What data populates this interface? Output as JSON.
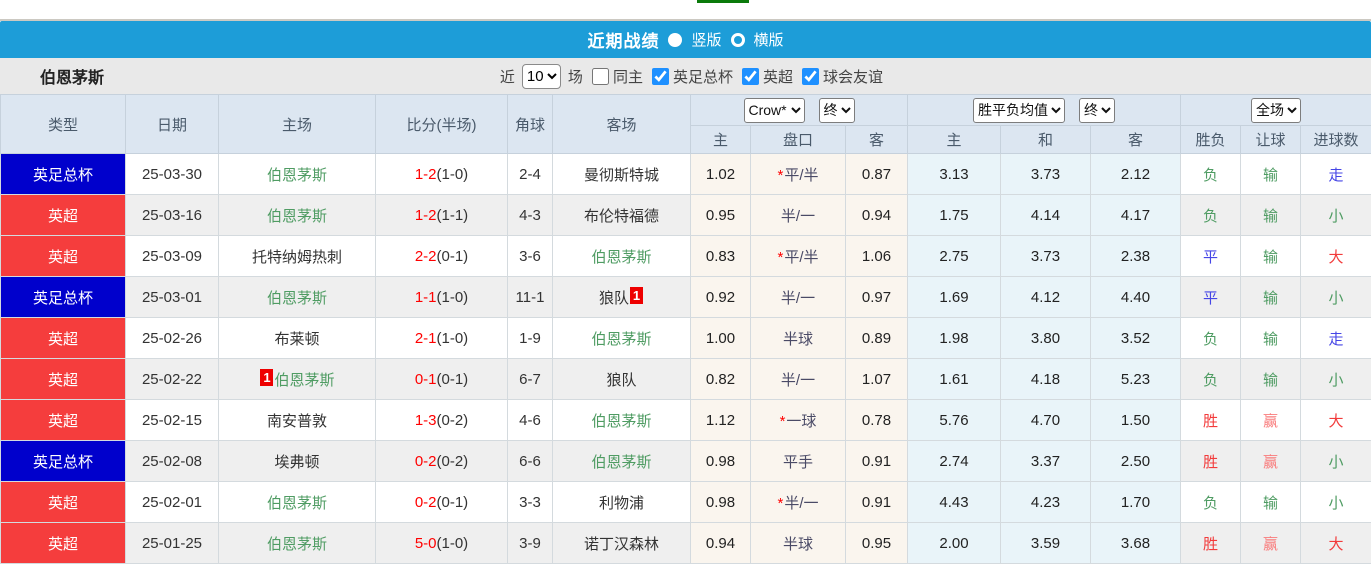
{
  "banner": {
    "title": "近期战绩",
    "radios": [
      {
        "label": "竖版",
        "selected": true
      },
      {
        "label": "横版",
        "selected": false
      }
    ]
  },
  "filter": {
    "team": "伯恩茅斯",
    "near_label": "近",
    "matches_value": "10",
    "matches_label": "场",
    "checkboxes": [
      {
        "label": "同主",
        "checked": false
      },
      {
        "label": "英足总杯",
        "checked": true
      },
      {
        "label": "英超",
        "checked": true
      },
      {
        "label": "球会友谊",
        "checked": true
      }
    ]
  },
  "table": {
    "main_headers": [
      "类型",
      "日期",
      "主场",
      "比分(半场)",
      "角球",
      "客场"
    ],
    "selects": {
      "company": "Crow*",
      "company_period": "终",
      "avg": "胜平负均值",
      "avg_period": "终",
      "scope": "全场"
    },
    "sub_headers": [
      "主",
      "盘口",
      "客",
      "主",
      "和",
      "客",
      "胜负",
      "让球",
      "进球数"
    ],
    "rows": [
      {
        "league": "英足总杯",
        "league_cls": "cup",
        "date": "25-03-30",
        "home": "伯恩茅斯",
        "home_green": true,
        "home_badge": "",
        "score": "1-2",
        "half": "(1-0)",
        "corner": "2-4",
        "away": "曼彻斯特城",
        "away_green": false,
        "away_badge": "",
        "odds_home": "1.02",
        "handicap": "平/半",
        "star": true,
        "odds_away": "0.87",
        "avg_home": "3.13",
        "avg_draw": "3.73",
        "avg_away": "2.12",
        "avg_draw_hot": false,
        "result": "负",
        "result_cls": "loss",
        "let_result": "输",
        "let_cls": "loss",
        "goals": "走",
        "goals_cls": "draw"
      },
      {
        "league": "英超",
        "league_cls": "epl",
        "date": "25-03-16",
        "home": "伯恩茅斯",
        "home_green": true,
        "home_badge": "",
        "score": "1-2",
        "half": "(1-1)",
        "corner": "4-3",
        "away": "布伦特福德",
        "away_green": false,
        "away_badge": "",
        "odds_home": "0.95",
        "handicap": "半/一",
        "star": false,
        "odds_away": "0.94",
        "avg_home": "1.75",
        "avg_draw": "4.14",
        "avg_away": "4.17",
        "avg_draw_hot": false,
        "result": "负",
        "result_cls": "loss",
        "let_result": "输",
        "let_cls": "loss",
        "goals": "小",
        "goals_cls": "loss"
      },
      {
        "league": "英超",
        "league_cls": "epl",
        "date": "25-03-09",
        "home": "托特纳姆热刺",
        "home_green": false,
        "home_badge": "",
        "score": "2-2",
        "half": "(0-1)",
        "corner": "3-6",
        "away": "伯恩茅斯",
        "away_green": true,
        "away_badge": "",
        "odds_home": "0.83",
        "handicap": "平/半",
        "star": true,
        "odds_away": "1.06",
        "avg_home": "2.75",
        "avg_draw": "3.73",
        "avg_away": "2.38",
        "avg_draw_hot": true,
        "result": "平",
        "result_cls": "draw",
        "let_result": "输",
        "let_cls": "loss",
        "goals": "大",
        "goals_cls": "win"
      },
      {
        "league": "英足总杯",
        "league_cls": "cup",
        "date": "25-03-01",
        "home": "伯恩茅斯",
        "home_green": true,
        "home_badge": "",
        "score": "1-1",
        "half": "(1-0)",
        "corner": "11-1",
        "away": "狼队",
        "away_green": false,
        "away_badge": "1",
        "odds_home": "0.92",
        "handicap": "半/一",
        "star": false,
        "odds_away": "0.97",
        "avg_home": "1.69",
        "avg_draw": "4.12",
        "avg_away": "4.40",
        "avg_draw_hot": false,
        "result": "平",
        "result_cls": "draw",
        "let_result": "输",
        "let_cls": "loss",
        "goals": "小",
        "goals_cls": "loss"
      },
      {
        "league": "英超",
        "league_cls": "epl",
        "date": "25-02-26",
        "home": "布莱顿",
        "home_green": false,
        "home_badge": "",
        "score": "2-1",
        "half": "(1-0)",
        "corner": "1-9",
        "away": "伯恩茅斯",
        "away_green": true,
        "away_badge": "",
        "odds_home": "1.00",
        "handicap": "半球",
        "star": false,
        "odds_away": "0.89",
        "avg_home": "1.98",
        "avg_draw": "3.80",
        "avg_away": "3.52",
        "avg_draw_hot": false,
        "result": "负",
        "result_cls": "loss",
        "let_result": "输",
        "let_cls": "loss",
        "goals": "走",
        "goals_cls": "draw"
      },
      {
        "league": "英超",
        "league_cls": "epl",
        "date": "25-02-22",
        "home": "伯恩茅斯",
        "home_green": true,
        "home_badge": "1",
        "score": "0-1",
        "half": "(0-1)",
        "corner": "6-7",
        "away": "狼队",
        "away_green": false,
        "away_badge": "",
        "odds_home": "0.82",
        "handicap": "半/一",
        "star": false,
        "odds_away": "1.07",
        "avg_home": "1.61",
        "avg_draw": "4.18",
        "avg_away": "5.23",
        "avg_draw_hot": false,
        "result": "负",
        "result_cls": "loss",
        "let_result": "输",
        "let_cls": "loss",
        "goals": "小",
        "goals_cls": "loss"
      },
      {
        "league": "英超",
        "league_cls": "epl",
        "date": "25-02-15",
        "home": "南安普敦",
        "home_green": false,
        "home_badge": "",
        "score": "1-3",
        "half": "(0-2)",
        "corner": "4-6",
        "away": "伯恩茅斯",
        "away_green": true,
        "away_badge": "",
        "odds_home": "1.12",
        "handicap": "一球",
        "star": true,
        "odds_away": "0.78",
        "avg_home": "5.76",
        "avg_draw": "4.70",
        "avg_away": "1.50",
        "avg_draw_hot": false,
        "result": "胜",
        "result_cls": "win",
        "let_result": "赢",
        "let_cls": "winlight",
        "goals": "大",
        "goals_cls": "win"
      },
      {
        "league": "英足总杯",
        "league_cls": "cup",
        "date": "25-02-08",
        "home": "埃弗顿",
        "home_green": false,
        "home_badge": "",
        "score": "0-2",
        "half": "(0-2)",
        "corner": "6-6",
        "away": "伯恩茅斯",
        "away_green": true,
        "away_badge": "",
        "odds_home": "0.98",
        "handicap": "平手",
        "star": false,
        "odds_away": "0.91",
        "avg_home": "2.74",
        "avg_draw": "3.37",
        "avg_away": "2.50",
        "avg_draw_hot": false,
        "result": "胜",
        "result_cls": "win",
        "let_result": "赢",
        "let_cls": "winlight",
        "goals": "小",
        "goals_cls": "loss"
      },
      {
        "league": "英超",
        "league_cls": "epl",
        "date": "25-02-01",
        "home": "伯恩茅斯",
        "home_green": true,
        "home_badge": "",
        "score": "0-2",
        "half": "(0-1)",
        "corner": "3-3",
        "away": "利物浦",
        "away_green": false,
        "away_badge": "",
        "odds_home": "0.98",
        "handicap": "半/一",
        "star": true,
        "odds_away": "0.91",
        "avg_home": "4.43",
        "avg_draw": "4.23",
        "avg_away": "1.70",
        "avg_draw_hot": false,
        "result": "负",
        "result_cls": "loss",
        "let_result": "输",
        "let_cls": "loss",
        "goals": "小",
        "goals_cls": "loss"
      },
      {
        "league": "英超",
        "league_cls": "epl",
        "date": "25-01-25",
        "home": "伯恩茅斯",
        "home_green": true,
        "home_badge": "",
        "score": "5-0",
        "half": "(1-0)",
        "corner": "3-9",
        "away": "诺丁汉森林",
        "away_green": false,
        "away_badge": "",
        "odds_home": "0.94",
        "handicap": "半球",
        "star": false,
        "odds_away": "0.95",
        "avg_home": "2.00",
        "avg_draw": "3.59",
        "avg_away": "3.68",
        "avg_draw_hot": false,
        "result": "胜",
        "result_cls": "win",
        "let_result": "赢",
        "let_cls": "winlight",
        "goals": "大",
        "goals_cls": "win"
      }
    ]
  }
}
